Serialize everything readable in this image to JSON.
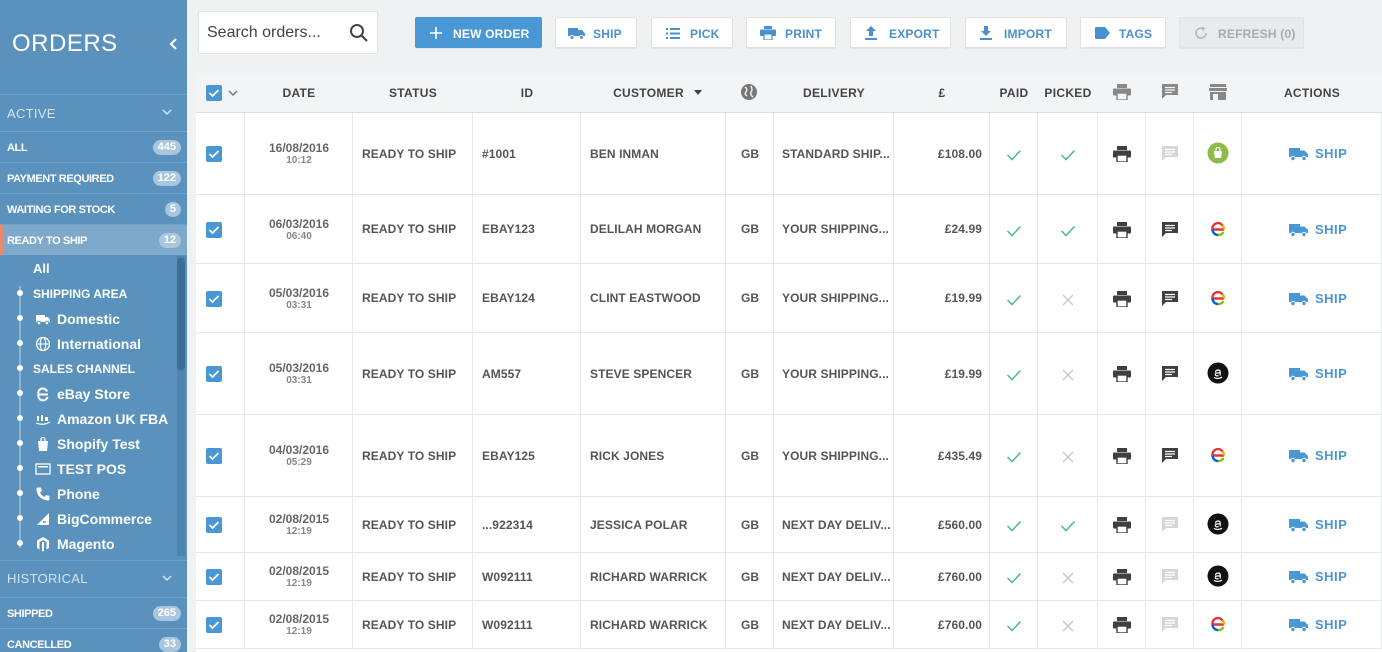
{
  "sidebar": {
    "title": "ORDERS",
    "active_section": "ACTIVE",
    "active_items": [
      {
        "label": "ALL",
        "count": "445"
      },
      {
        "label": "PAYMENT REQUIRED",
        "count": "122"
      },
      {
        "label": "WAITING FOR STOCK",
        "count": "5"
      },
      {
        "label": "READY TO SHIP",
        "count": "12"
      }
    ],
    "tree": {
      "all": "All",
      "shipping_area": "SHIPPING AREA",
      "domestic": "Domestic",
      "international": "International",
      "sales_channel": "SALES CHANNEL",
      "ebay": "eBay Store",
      "amazon": "Amazon UK FBA",
      "shopify": "Shopify Test",
      "pos": "TEST POS",
      "phone": "Phone",
      "bigcommerce": "BigCommerce",
      "magento": "Magento"
    },
    "historical_section": "HISTORICAL",
    "historical_items": [
      {
        "label": "SHIPPED",
        "count": "265"
      },
      {
        "label": "CANCELLED",
        "count": "33"
      }
    ]
  },
  "toolbar": {
    "search_placeholder": "Search orders...",
    "new_order": "NEW ORDER",
    "ship": "SHIP",
    "pick": "PICK",
    "print": "PRINT",
    "export": "EXPORT",
    "import": "IMPORT",
    "tags": "TAGS",
    "refresh": "REFRESH (0)"
  },
  "table": {
    "headers": {
      "date": "DATE",
      "status": "STATUS",
      "id": "ID",
      "customer": "CUSTOMER",
      "delivery": "DELIVERY",
      "currency": "£",
      "paid": "PAID",
      "picked": "PICKED",
      "actions": "ACTIONS"
    },
    "action_label": "SHIP",
    "rows": [
      {
        "date": "16/08/2016",
        "time": "10:12",
        "status": "READY TO SHIP",
        "id": "#1001",
        "customer": "BEN INMAN",
        "country": "GB",
        "delivery": "STANDARD SHIP...",
        "total": "£108.00",
        "paid": true,
        "picked": true,
        "note": false,
        "channel": "shopify"
      },
      {
        "date": "06/03/2016",
        "time": "06:40",
        "status": "READY TO SHIP",
        "id": "EBAY123",
        "customer": "DELILAH MORGAN",
        "country": "GB",
        "delivery": "YOUR SHIPPING...",
        "total": "£24.99",
        "paid": true,
        "picked": true,
        "note": true,
        "channel": "ebay"
      },
      {
        "date": "05/03/2016",
        "time": "03:31",
        "status": "READY TO SHIP",
        "id": "EBAY124",
        "customer": "CLINT EASTWOOD",
        "country": "GB",
        "delivery": "YOUR SHIPPING...",
        "total": "£19.99",
        "paid": true,
        "picked": false,
        "note": true,
        "channel": "ebay"
      },
      {
        "date": "05/03/2016",
        "time": "03:31",
        "status": "READY TO SHIP",
        "id": "AM557",
        "customer": "STEVE SPENCER",
        "country": "GB",
        "delivery": "YOUR SHIPPING...",
        "total": "£19.99",
        "paid": true,
        "picked": false,
        "note": true,
        "channel": "amazon"
      },
      {
        "date": "04/03/2016",
        "time": "05:29",
        "status": "READY TO SHIP",
        "id": "EBAY125",
        "customer": "RICK JONES",
        "country": "GB",
        "delivery": "YOUR SHIPPING...",
        "total": "£435.49",
        "paid": true,
        "picked": false,
        "note": true,
        "channel": "ebay"
      },
      {
        "date": "02/08/2015",
        "time": "12:19",
        "status": "READY TO SHIP",
        "id": "...922314",
        "customer": "JESSICA POLAR",
        "country": "GB",
        "delivery": "NEXT DAY DELIV...",
        "total": "£560.00",
        "paid": true,
        "picked": true,
        "note": false,
        "channel": "amazon"
      },
      {
        "date": "02/08/2015",
        "time": "12:19",
        "status": "READY TO SHIP",
        "id": "W092111",
        "customer": "RICHARD WARRICK",
        "country": "GB",
        "delivery": "NEXT DAY DELIV...",
        "total": "£760.00",
        "paid": true,
        "picked": false,
        "note": false,
        "channel": "amazon"
      },
      {
        "date": "02/08/2015",
        "time": "12:19",
        "status": "READY TO SHIP",
        "id": "W092111",
        "customer": "RICHARD WARRICK",
        "country": "GB",
        "delivery": "NEXT DAY DELIV...",
        "total": "£760.00",
        "paid": true,
        "picked": false,
        "note": false,
        "channel": "ebay"
      }
    ]
  },
  "colors": {
    "sidebar_bg": "#5a92bd",
    "accent_blue": "#4a97d6",
    "check_green": "#4cbb7f",
    "cross_grey": "#c5c8cc",
    "active_marker": "#e8896b"
  }
}
